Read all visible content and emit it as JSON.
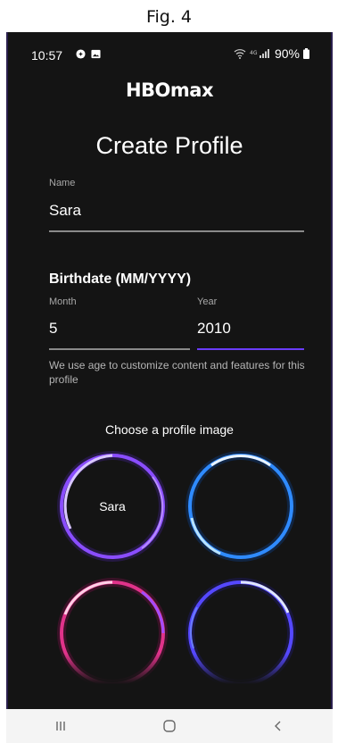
{
  "figure": {
    "caption": "Fig. 4"
  },
  "status_bar": {
    "time": "10:57",
    "battery": "90%"
  },
  "app": {
    "logo": "HBOmax"
  },
  "page": {
    "title": "Create Profile"
  },
  "name_field": {
    "label": "Name",
    "value": "Sara"
  },
  "birthdate": {
    "heading": "Birthdate (MM/YYYY)",
    "month_label": "Month",
    "month_value": "5",
    "year_label": "Year",
    "year_value": "2010",
    "helper": "We use age to customize content and features for this profile"
  },
  "profile_image": {
    "heading": "Choose a profile image",
    "options": [
      {
        "label": "Sara",
        "color": "#8a4dff"
      },
      {
        "label": "",
        "color": "#2f8bff"
      },
      {
        "label": "",
        "color": "#e0338a"
      },
      {
        "label": "",
        "color": "#5548ff"
      }
    ]
  },
  "colors": {
    "background": "#141414",
    "accent": "#6a3cff"
  },
  "nav_bar": {
    "recents_icon": "recents-icon",
    "home_icon": "home-icon",
    "back_icon": "back-icon"
  }
}
